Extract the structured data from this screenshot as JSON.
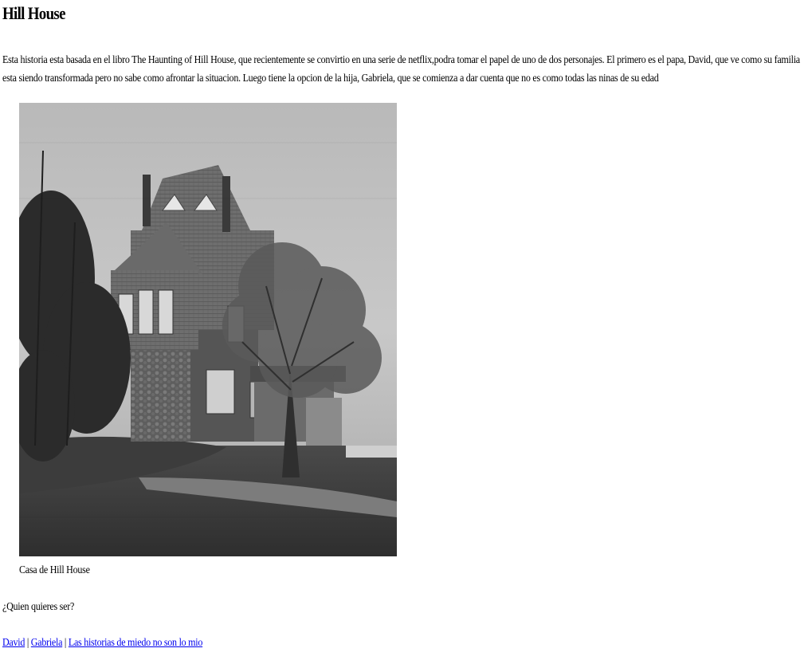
{
  "page": {
    "title": "Hill House",
    "intro": "Esta historia esta basada en el libro The Haunting of Hill House, que recientemente se convirtio en una serie de netflix,podra tomar el papel de uno de dos personajes. El primero es el papa, David, que ve como su familia esta siendo transformada pero no sabe como afrontar la situacion. Luego tiene la opcion de la hija, Gabriela, que se comienza a dar cuenta que no es como todas las ninas de su edad"
  },
  "figure": {
    "image_name": "hill-house-photo",
    "caption": "Casa de Hill House"
  },
  "question": "¿Quien quieres ser?",
  "links": [
    {
      "label": "David"
    },
    {
      "label": "Gabriela"
    },
    {
      "label": "Las historias de miedo no son lo mio"
    }
  ],
  "separator": " | ",
  "colors": {
    "link": "#0000ee",
    "text": "#000000",
    "background": "#ffffff"
  }
}
